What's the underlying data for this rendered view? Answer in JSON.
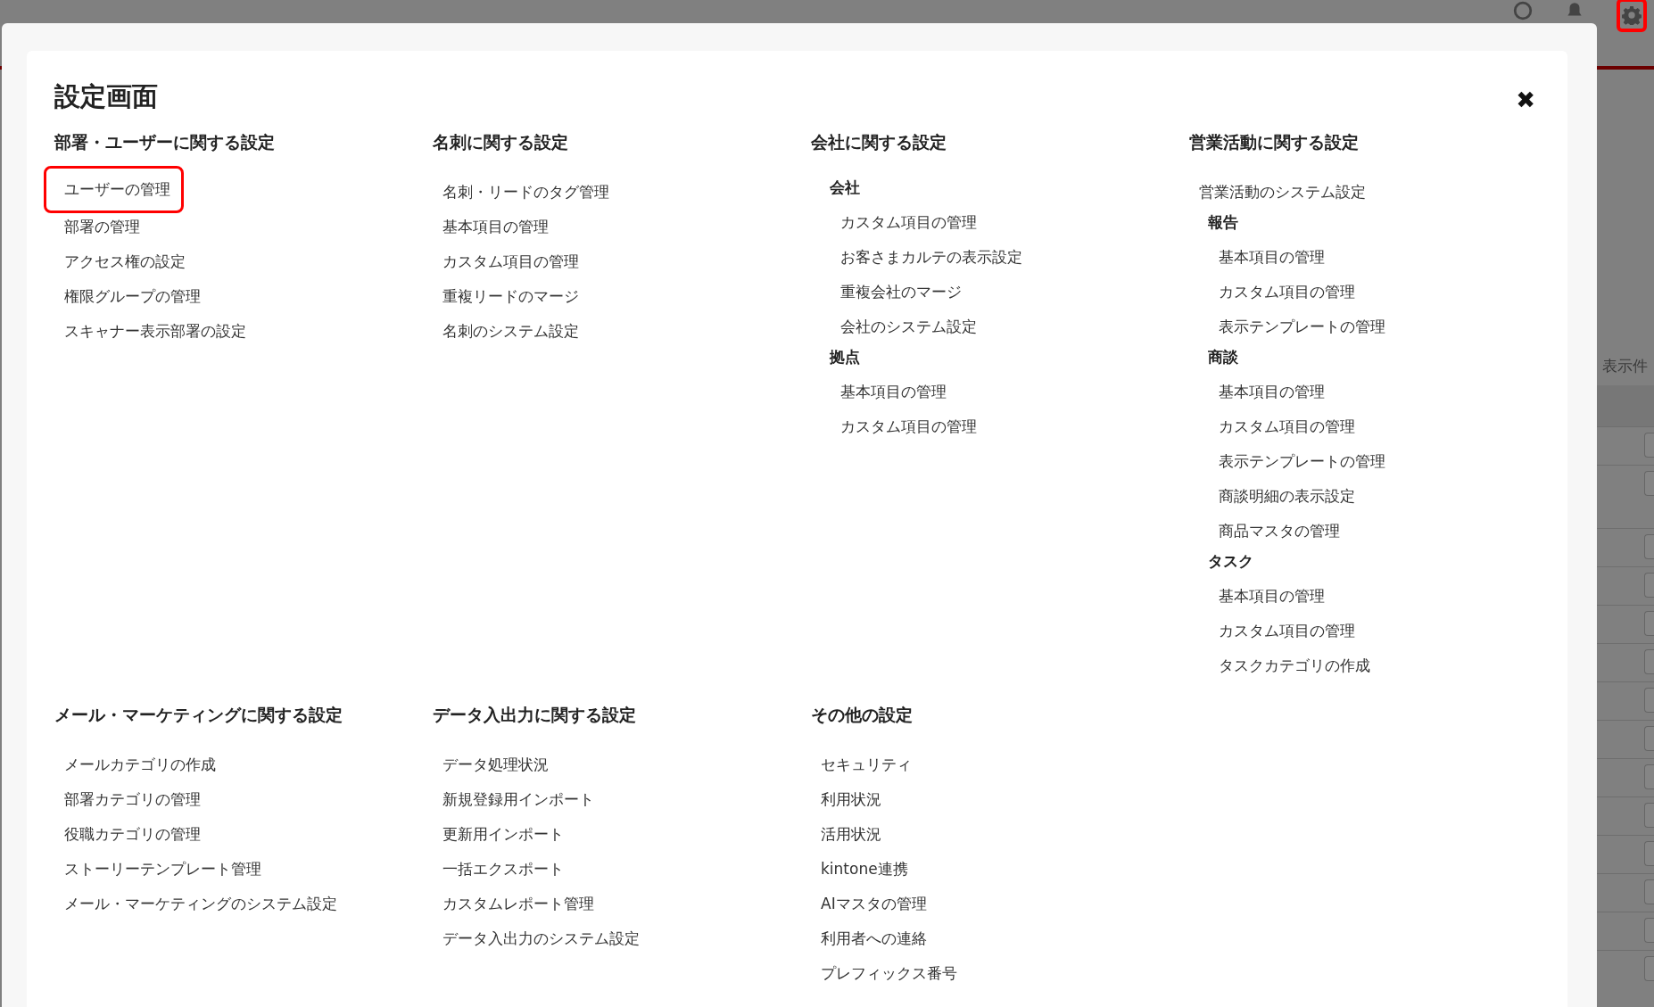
{
  "top_bar": {
    "settings_highlighted": true
  },
  "background": {
    "count_label": "表示件"
  },
  "dialog": {
    "title": "設定画面",
    "close": "✖",
    "section_rows": [
      [
        {
          "title": "部署・ユーザーに関する設定",
          "groups": [
            {
              "items": [
                {
                  "label": "ユーザーの管理",
                  "highlighted": true
                },
                {
                  "label": "部署の管理",
                  "highlighted": false
                },
                {
                  "label": "アクセス権の設定",
                  "highlighted": false
                },
                {
                  "label": "権限グループの管理",
                  "highlighted": false
                },
                {
                  "label": "スキャナー表示部署の設定",
                  "highlighted": false
                }
              ]
            }
          ]
        },
        {
          "title": "名刺に関する設定",
          "groups": [
            {
              "items": [
                {
                  "label": "名刺・リードのタグ管理",
                  "highlighted": false
                },
                {
                  "label": "基本項目の管理",
                  "highlighted": false
                },
                {
                  "label": "カスタム項目の管理",
                  "highlighted": false
                },
                {
                  "label": "重複リードのマージ",
                  "highlighted": false
                },
                {
                  "label": "名刺のシステム設定",
                  "highlighted": false
                }
              ]
            }
          ]
        },
        {
          "title": "会社に関する設定",
          "groups": [
            {
              "label": "会社",
              "items": [
                {
                  "label": "カスタム項目の管理",
                  "highlighted": false
                },
                {
                  "label": "お客さまカルテの表示設定",
                  "highlighted": false
                },
                {
                  "label": "重複会社のマージ",
                  "highlighted": false
                },
                {
                  "label": "会社のシステム設定",
                  "highlighted": false
                }
              ]
            },
            {
              "label": "拠点",
              "items": [
                {
                  "label": "基本項目の管理",
                  "highlighted": false
                },
                {
                  "label": "カスタム項目の管理",
                  "highlighted": false
                }
              ]
            }
          ]
        },
        {
          "title": "営業活動に関する設定",
          "groups": [
            {
              "items": [
                {
                  "label": "営業活動のシステム設定",
                  "highlighted": false
                }
              ]
            },
            {
              "label": "報告",
              "items": [
                {
                  "label": "基本項目の管理",
                  "highlighted": false
                },
                {
                  "label": "カスタム項目の管理",
                  "highlighted": false
                },
                {
                  "label": "表示テンプレートの管理",
                  "highlighted": false
                }
              ]
            },
            {
              "label": "商談",
              "items": [
                {
                  "label": "基本項目の管理",
                  "highlighted": false
                },
                {
                  "label": "カスタム項目の管理",
                  "highlighted": false
                },
                {
                  "label": "表示テンプレートの管理",
                  "highlighted": false
                },
                {
                  "label": "商談明細の表示設定",
                  "highlighted": false
                },
                {
                  "label": "商品マスタの管理",
                  "highlighted": false
                }
              ]
            },
            {
              "label": "タスク",
              "items": [
                {
                  "label": "基本項目の管理",
                  "highlighted": false
                },
                {
                  "label": "カスタム項目の管理",
                  "highlighted": false
                },
                {
                  "label": "タスクカテゴリの作成",
                  "highlighted": false
                }
              ]
            }
          ]
        }
      ],
      [
        {
          "title": "メール・マーケティングに関する設定",
          "groups": [
            {
              "items": [
                {
                  "label": "メールカテゴリの作成",
                  "highlighted": false
                },
                {
                  "label": "部署カテゴリの管理",
                  "highlighted": false
                },
                {
                  "label": "役職カテゴリの管理",
                  "highlighted": false
                },
                {
                  "label": "ストーリーテンプレート管理",
                  "highlighted": false
                },
                {
                  "label": "メール・マーケティングのシステム設定",
                  "highlighted": false
                }
              ]
            }
          ]
        },
        {
          "title": "データ入出力に関する設定",
          "groups": [
            {
              "items": [
                {
                  "label": "データ処理状況",
                  "highlighted": false
                },
                {
                  "label": "新規登録用インポート",
                  "highlighted": false
                },
                {
                  "label": "更新用インポート",
                  "highlighted": false
                },
                {
                  "label": "一括エクスポート",
                  "highlighted": false
                },
                {
                  "label": "カスタムレポート管理",
                  "highlighted": false
                },
                {
                  "label": "データ入出力のシステム設定",
                  "highlighted": false
                }
              ]
            }
          ]
        },
        {
          "title": "その他の設定",
          "groups": [
            {
              "items": [
                {
                  "label": "セキュリティ",
                  "highlighted": false
                },
                {
                  "label": "利用状況",
                  "highlighted": false
                },
                {
                  "label": "活用状況",
                  "highlighted": false
                },
                {
                  "label": "kintone連携",
                  "highlighted": false
                },
                {
                  "label": "AIマスタの管理",
                  "highlighted": false
                },
                {
                  "label": "利用者への連絡",
                  "highlighted": false
                },
                {
                  "label": "プレフィックス番号",
                  "highlighted": false
                }
              ]
            }
          ]
        }
      ]
    ]
  }
}
